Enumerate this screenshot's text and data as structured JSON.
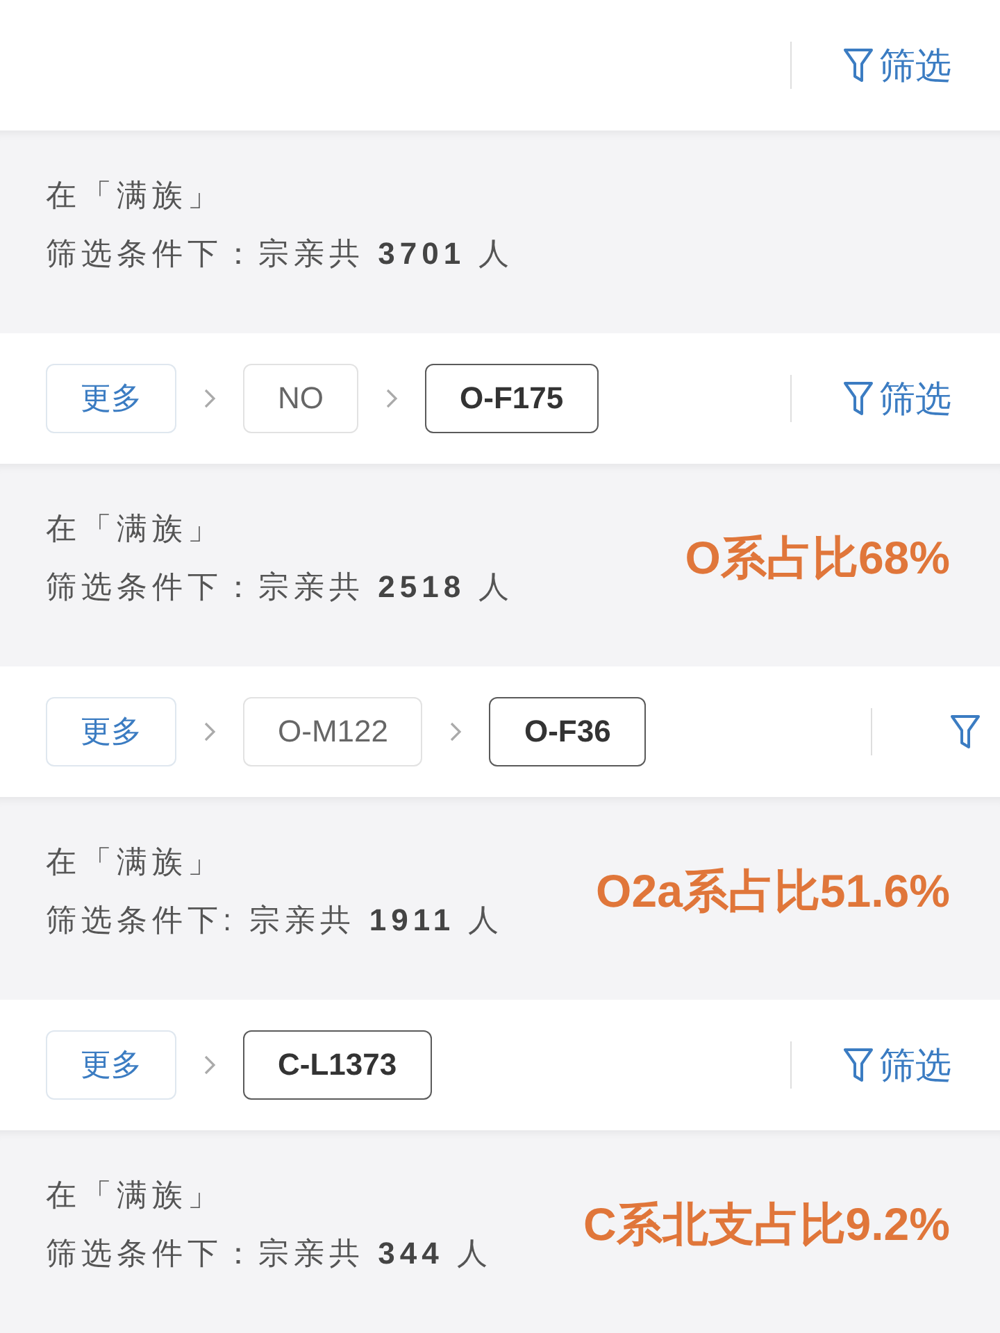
{
  "panels": [
    {
      "toolbar": {
        "filter": {
          "kind": "full",
          "label": "筛选"
        }
      },
      "result": {
        "scope": "在「满族」",
        "summary": "筛选条件下：宗亲共 **3701** 人"
      }
    },
    {
      "toolbar": {
        "crumbs": [
          {
            "kind": "more",
            "label": "更多",
            "selected": false
          },
          {
            "kind": "node",
            "label": "NO",
            "selected": false
          },
          {
            "kind": "node",
            "label": "O-F175",
            "selected": true
          }
        ],
        "filter": {
          "kind": "full",
          "label": "筛选"
        }
      },
      "result": {
        "scope": "在「满族」",
        "summary": "筛选条件下：宗亲共 **2518** 人",
        "annotation": "O系占比68%"
      }
    },
    {
      "toolbar": {
        "crumbs": [
          {
            "kind": "more",
            "label": "更多",
            "selected": false
          },
          {
            "kind": "node",
            "label": "O-M122",
            "selected": false
          },
          {
            "kind": "node",
            "label": "O-F36",
            "selected": true
          }
        ],
        "filter": {
          "kind": "clipped"
        }
      },
      "result": {
        "scope": "在「满族」",
        "summary": "筛选条件下: 宗亲共 **1911** 人",
        "annotation": "O2a系占比51.6%"
      }
    },
    {
      "toolbar": {
        "crumbs": [
          {
            "kind": "more",
            "label": "更多",
            "selected": false
          },
          {
            "kind": "node",
            "label": "C-L1373",
            "selected": true
          }
        ],
        "filter": {
          "kind": "full",
          "label": "筛选"
        }
      },
      "result": {
        "scope": "在「满族」",
        "summary": "筛选条件下：宗亲共 **344** 人",
        "annotation": "C系北支占比9.2%"
      }
    }
  ]
}
